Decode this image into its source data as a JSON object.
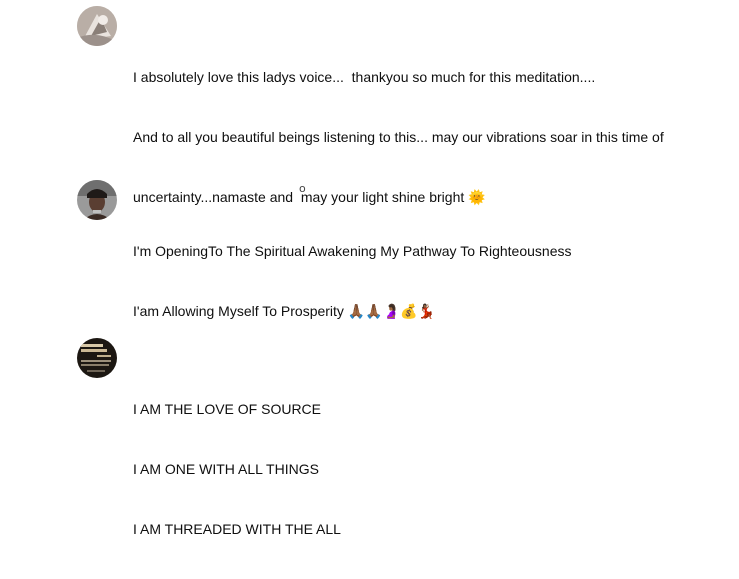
{
  "comments": [
    {
      "lines": [
        "I absolutely love this ladys voice...  thankyou so much for this meditation....",
        "And to all you beautiful beings listening to this... may our vibrations soar in this time of",
        "uncertainty...namaste and  may your light shine bright 🌞"
      ]
    },
    {
      "mark": "o",
      "lines": [
        "I'm OpeningTo The Spiritual Awakening My Pathway To Righteousness",
        "I'am Allowing Myself To Prosperity 🙏🏾🙏🏾🤰🏾💰💃🏾"
      ]
    },
    {
      "lines": [
        "I AM THE LOVE OF SOURCE",
        "I AM ONE WITH ALL THINGS",
        "I AM THREADED WITH THE ALL"
      ]
    }
  ]
}
